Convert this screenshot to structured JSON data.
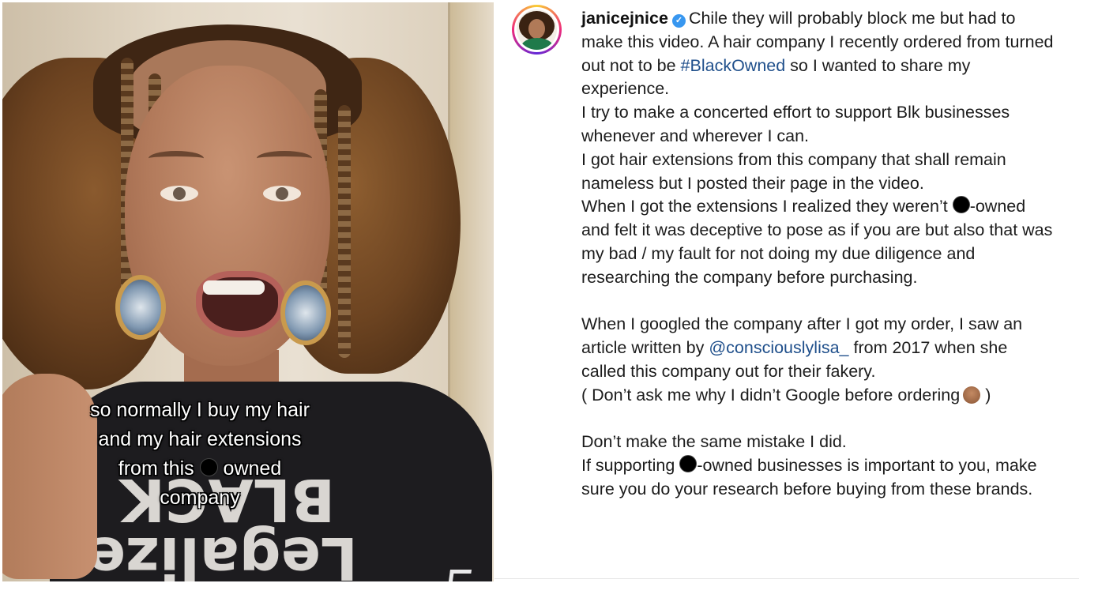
{
  "video": {
    "caption_lines": [
      "so normally I buy my hair",
      "and my hair extensions",
      "from this",
      "owned",
      "company"
    ],
    "shirt_print": "Legalize BLACK"
  },
  "post": {
    "username": "janicejnice",
    "verified_icon": "verified-badge-icon",
    "intro": "Chile they will probably block me but had to make this video. A hair company I recently ordered from turned out not to be",
    "hashtag": "#BlackOwned",
    "intro_end": "so I wanted to share my experience.",
    "line2": "I try to make a concerted effort to support Blk businesses whenever and wherever I can.",
    "line3": "I got hair extensions from this company that shall remain nameless but I posted their page in the video.",
    "line4_start": "When I got the extensions I realized they weren’t",
    "line4_end": "-owned and felt it was deceptive to pose as if you are but also that was my bad / my fault for not doing my due diligence and researching the company before purchasing.",
    "para2_start": "When I googled the company after I got my order, I saw an article written by",
    "mention": "@consciouslylisa_",
    "para2_end": "from 2017 when she called this company out for their fakery.",
    "para2_note": "( Don’t ask me why I didn’t Google before ordering",
    "para2_note_end": ")",
    "para3_line1": "Don’t make the same mistake I did.",
    "para3_start": "If supporting",
    "para3_end": "-owned businesses is important to you, make sure you do your research before buying from these brands."
  },
  "colors": {
    "link": "#1f4f8b",
    "verified": "#3897f0",
    "text": "#1c1c1c"
  }
}
